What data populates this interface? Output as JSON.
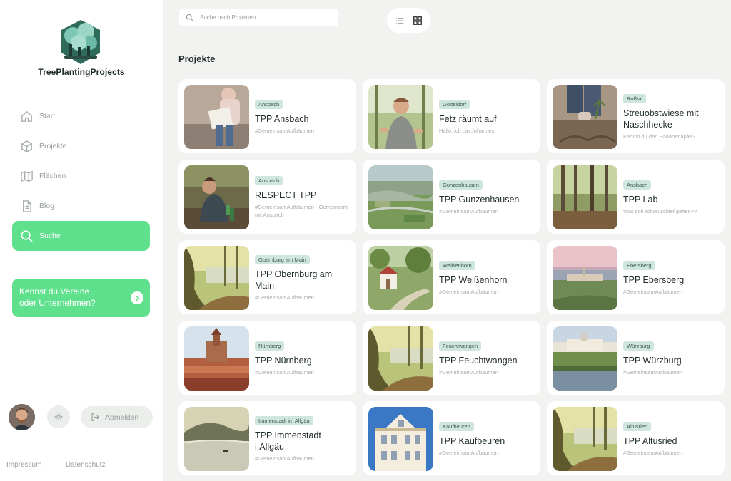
{
  "brand": {
    "name": "TreePlantingProjects"
  },
  "nav": [
    {
      "key": "start",
      "label": "Start",
      "icon": "home-icon"
    },
    {
      "key": "projekte",
      "label": "Projekte",
      "icon": "box-icon"
    },
    {
      "key": "flaechen",
      "label": "Flächen",
      "icon": "map-icon"
    },
    {
      "key": "blog",
      "label": "Blog",
      "icon": "document-icon"
    },
    {
      "key": "suche",
      "label": "Suche",
      "icon": "search-icon",
      "active": true
    }
  ],
  "promo": {
    "line1": "Kennst du Vereine",
    "line2": "oder Unternehmen?",
    "icon": "chevron-right-icon"
  },
  "account": {
    "logout_label": "Abmelden"
  },
  "footer": {
    "impressum": "Impressum",
    "datenschutz": "Datenschutz"
  },
  "search": {
    "placeholder": "Suche nach Projekten",
    "value": ""
  },
  "view_toggle": {
    "options": [
      "list-icon",
      "grid-icon"
    ],
    "selected": "grid-icon"
  },
  "section_title": "Projekte",
  "colors": {
    "accent": "#5fe08c",
    "tag_bg": "#cfe6df",
    "background": "#f2f3f1"
  },
  "projects": [
    {
      "tag": "Ansbach",
      "title": "TPP Ansbach",
      "subtitle": "#GemeinsamAufbäumen",
      "thumb": "kids-with-sign"
    },
    {
      "tag": "Götteldorf",
      "title": "Fetz räumt auf",
      "subtitle": "Hallo, ich bin Johannes.",
      "thumb": "man-in-forest"
    },
    {
      "tag": "Roßtal",
      "title": "Streuobstwiese mit Naschhecke",
      "subtitle": "Kennst du den Bananenapfel?",
      "thumb": "planting-hands"
    },
    {
      "tag": "Ansbach",
      "title": "RESPECT TPP",
      "subtitle": "#GemeinsamAufbäumen - Gemeinsam mit Ansbach",
      "thumb": "planting-person"
    },
    {
      "tag": "Gunzenhausen",
      "title": "TPP Gunzenhausen",
      "subtitle": "#GemeinsamAufbäumen",
      "thumb": "aerial-landscape"
    },
    {
      "tag": "Ansbach",
      "title": "TPP Lab",
      "subtitle": "Was soll schon schief gehen??",
      "thumb": "forest-floor"
    },
    {
      "tag": "Obernburg am Main",
      "title": "TPP Obernburg am Main",
      "subtitle": "#GemeinsamAufbäumen",
      "thumb": "forest-lake"
    },
    {
      "tag": "Weißenhorn",
      "title": "TPP Weißenhorn",
      "subtitle": "#GemeinsamAufbäumen",
      "thumb": "chapel-path"
    },
    {
      "tag": "Ebersberg",
      "title": "TPP Ebersberg",
      "subtitle": "#GemeinsamAufbäumen",
      "thumb": "town-sunset"
    },
    {
      "tag": "Nürnberg",
      "title": "TPP Nürnberg",
      "subtitle": "#GemeinsamAufbäumen",
      "thumb": "castle-city"
    },
    {
      "tag": "Feuchtwangen",
      "title": "TPP Feuchtwangen",
      "subtitle": "#GemeinsamAufbäumen",
      "thumb": "forest-lake"
    },
    {
      "tag": "Würzburg",
      "title": "TPP Würzburg",
      "subtitle": "#GemeinsamAufbäumen",
      "thumb": "fortress-river"
    },
    {
      "tag": "Immenstadt im Allgäu",
      "title": "TPP Immenstadt i.Allgäu",
      "subtitle": "#GemeinsamAufbäumen",
      "thumb": "mountain-lake"
    },
    {
      "tag": "Kaufbeuren",
      "title": "TPP Kaufbeuren",
      "subtitle": "#GemeinsamAufbäumen",
      "thumb": "building-facade"
    },
    {
      "tag": "Altusried",
      "title": "TPP Altusried",
      "subtitle": "#GemeinsamAufbäumen",
      "thumb": "forest-lake"
    }
  ]
}
